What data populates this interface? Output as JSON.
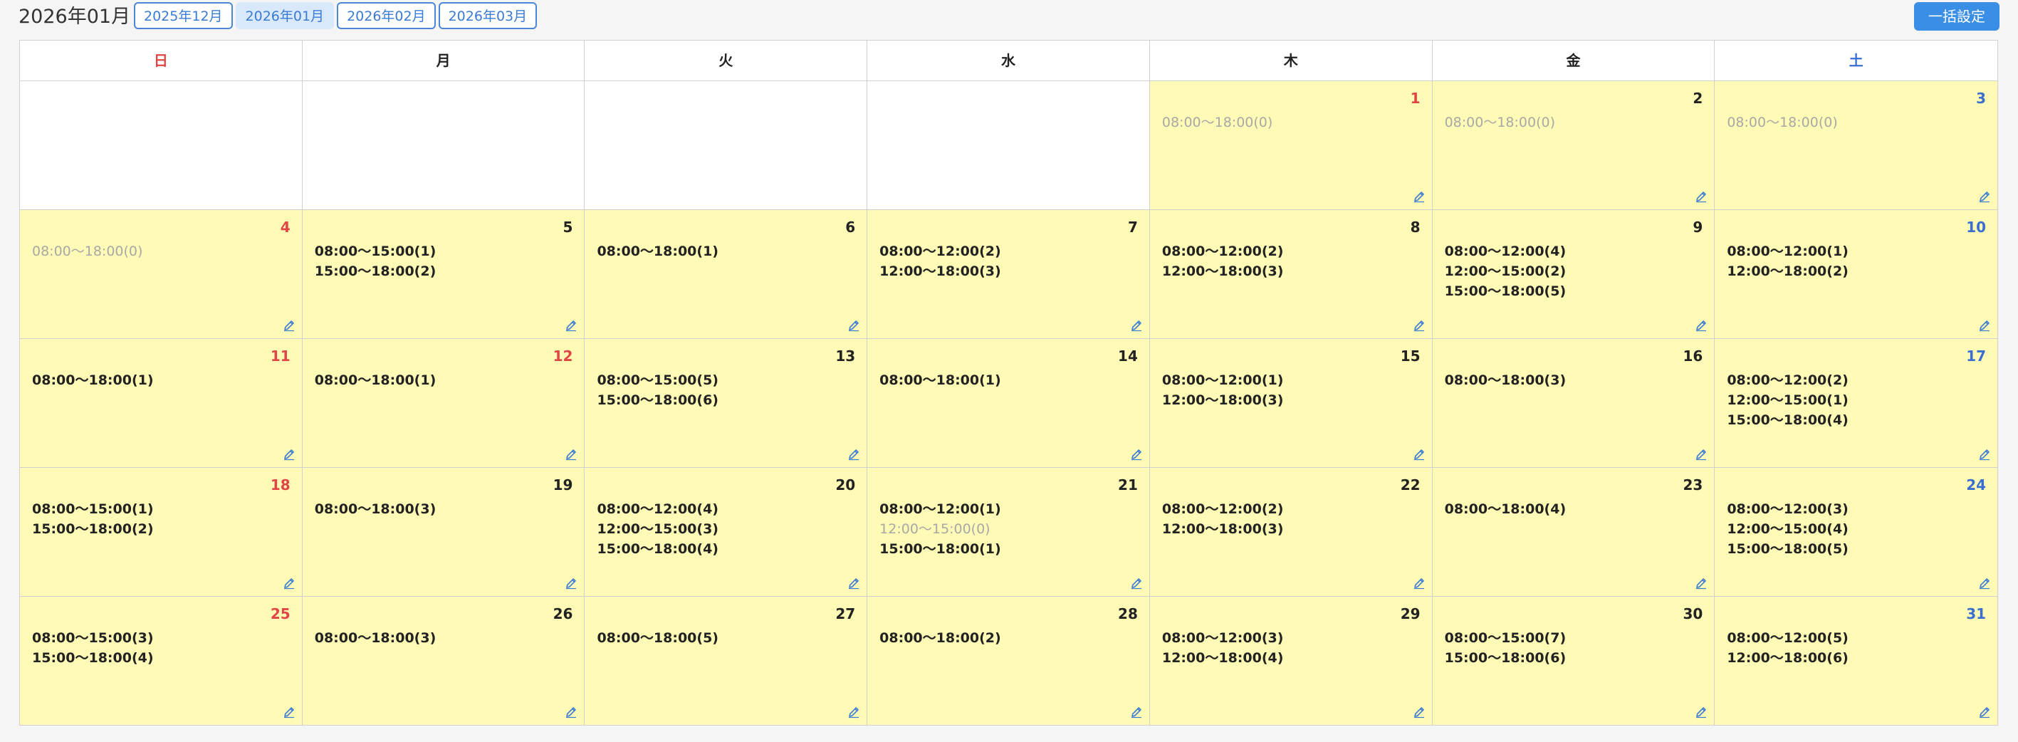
{
  "header": {
    "title": "2026年01月",
    "tabs": [
      {
        "label": "2025年12月",
        "active": false
      },
      {
        "label": "2026年01月",
        "active": true
      },
      {
        "label": "2026年02月",
        "active": false
      },
      {
        "label": "2026年03月",
        "active": false
      }
    ],
    "bulk_button": "一括設定"
  },
  "weekdays": [
    "日",
    "月",
    "火",
    "水",
    "木",
    "金",
    "土"
  ],
  "weeks": [
    [
      null,
      null,
      null,
      null,
      {
        "day": "1",
        "color": "holiday",
        "slots": [
          {
            "text": "08:00〜18:00(0)",
            "empty": true
          }
        ]
      },
      {
        "day": "2",
        "color": "normal",
        "slots": [
          {
            "text": "08:00〜18:00(0)",
            "empty": true
          }
        ]
      },
      {
        "day": "3",
        "color": "sat",
        "slots": [
          {
            "text": "08:00〜18:00(0)",
            "empty": true
          }
        ]
      }
    ],
    [
      {
        "day": "4",
        "color": "holiday",
        "slots": [
          {
            "text": "08:00〜18:00(0)",
            "empty": true
          }
        ]
      },
      {
        "day": "5",
        "color": "normal",
        "slots": [
          {
            "text": "08:00〜15:00(1)"
          },
          {
            "text": "15:00〜18:00(2)"
          }
        ]
      },
      {
        "day": "6",
        "color": "normal",
        "slots": [
          {
            "text": "08:00〜18:00(1)"
          }
        ]
      },
      {
        "day": "7",
        "color": "normal",
        "slots": [
          {
            "text": "08:00〜12:00(2)"
          },
          {
            "text": "12:00〜18:00(3)"
          }
        ]
      },
      {
        "day": "8",
        "color": "normal",
        "slots": [
          {
            "text": "08:00〜12:00(2)"
          },
          {
            "text": "12:00〜18:00(3)"
          }
        ]
      },
      {
        "day": "9",
        "color": "normal",
        "slots": [
          {
            "text": "08:00〜12:00(4)"
          },
          {
            "text": "12:00〜15:00(2)"
          },
          {
            "text": "15:00〜18:00(5)"
          }
        ]
      },
      {
        "day": "10",
        "color": "sat",
        "slots": [
          {
            "text": "08:00〜12:00(1)"
          },
          {
            "text": "12:00〜18:00(2)"
          }
        ]
      }
    ],
    [
      {
        "day": "11",
        "color": "holiday",
        "slots": [
          {
            "text": "08:00〜18:00(1)"
          }
        ]
      },
      {
        "day": "12",
        "color": "holiday",
        "slots": [
          {
            "text": "08:00〜18:00(1)"
          }
        ]
      },
      {
        "day": "13",
        "color": "normal",
        "slots": [
          {
            "text": "08:00〜15:00(5)"
          },
          {
            "text": "15:00〜18:00(6)"
          }
        ]
      },
      {
        "day": "14",
        "color": "normal",
        "slots": [
          {
            "text": "08:00〜18:00(1)"
          }
        ]
      },
      {
        "day": "15",
        "color": "normal",
        "slots": [
          {
            "text": "08:00〜12:00(1)"
          },
          {
            "text": "12:00〜18:00(3)"
          }
        ]
      },
      {
        "day": "16",
        "color": "normal",
        "slots": [
          {
            "text": "08:00〜18:00(3)"
          }
        ]
      },
      {
        "day": "17",
        "color": "sat",
        "slots": [
          {
            "text": "08:00〜12:00(2)"
          },
          {
            "text": "12:00〜15:00(1)"
          },
          {
            "text": "15:00〜18:00(4)"
          }
        ]
      }
    ],
    [
      {
        "day": "18",
        "color": "holiday",
        "slots": [
          {
            "text": "08:00〜15:00(1)"
          },
          {
            "text": "15:00〜18:00(2)"
          }
        ]
      },
      {
        "day": "19",
        "color": "normal",
        "slots": [
          {
            "text": "08:00〜18:00(3)"
          }
        ]
      },
      {
        "day": "20",
        "color": "normal",
        "slots": [
          {
            "text": "08:00〜12:00(4)"
          },
          {
            "text": "12:00〜15:00(3)"
          },
          {
            "text": "15:00〜18:00(4)"
          }
        ]
      },
      {
        "day": "21",
        "color": "normal",
        "slots": [
          {
            "text": "08:00〜12:00(1)"
          },
          {
            "text": "12:00〜15:00(0)",
            "empty": true
          },
          {
            "text": "15:00〜18:00(1)"
          }
        ]
      },
      {
        "day": "22",
        "color": "normal",
        "slots": [
          {
            "text": "08:00〜12:00(2)"
          },
          {
            "text": "12:00〜18:00(3)"
          }
        ]
      },
      {
        "day": "23",
        "color": "normal",
        "slots": [
          {
            "text": "08:00〜18:00(4)"
          }
        ]
      },
      {
        "day": "24",
        "color": "sat",
        "slots": [
          {
            "text": "08:00〜12:00(3)"
          },
          {
            "text": "12:00〜15:00(4)"
          },
          {
            "text": "15:00〜18:00(5)"
          }
        ]
      }
    ],
    [
      {
        "day": "25",
        "color": "holiday",
        "slots": [
          {
            "text": "08:00〜15:00(3)"
          },
          {
            "text": "15:00〜18:00(4)"
          }
        ]
      },
      {
        "day": "26",
        "color": "normal",
        "slots": [
          {
            "text": "08:00〜18:00(3)"
          }
        ]
      },
      {
        "day": "27",
        "color": "normal",
        "slots": [
          {
            "text": "08:00〜18:00(5)"
          }
        ]
      },
      {
        "day": "28",
        "color": "normal",
        "slots": [
          {
            "text": "08:00〜18:00(2)"
          }
        ]
      },
      {
        "day": "29",
        "color": "normal",
        "slots": [
          {
            "text": "08:00〜12:00(3)"
          },
          {
            "text": "12:00〜18:00(4)"
          }
        ]
      },
      {
        "day": "30",
        "color": "normal",
        "slots": [
          {
            "text": "08:00〜15:00(7)"
          },
          {
            "text": "15:00〜18:00(6)"
          }
        ]
      },
      {
        "day": "31",
        "color": "sat",
        "slots": [
          {
            "text": "08:00〜12:00(5)"
          },
          {
            "text": "12:00〜18:00(6)"
          }
        ]
      }
    ]
  ],
  "colors": {
    "cell_fill": "#fffab5",
    "holiday": "#e04646",
    "saturday": "#3a6fd1",
    "accent": "#3a8ee6"
  },
  "icons": {
    "edit": "pencil-icon"
  }
}
